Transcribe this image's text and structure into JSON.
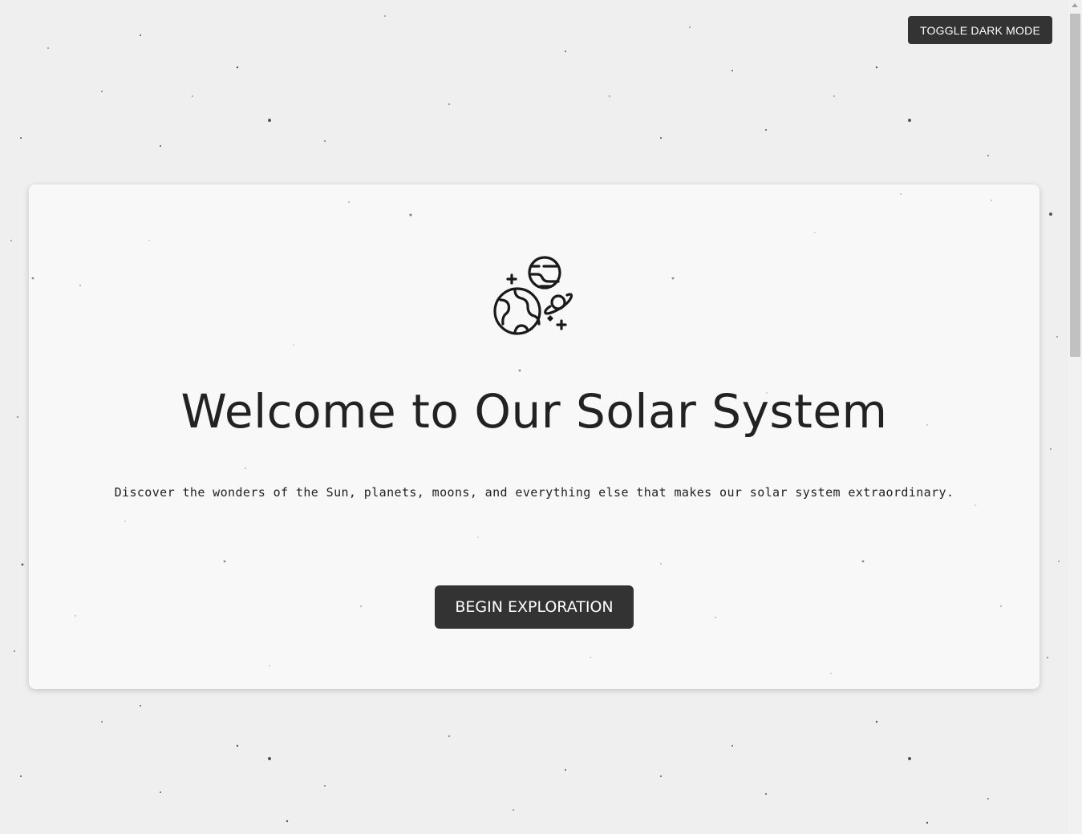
{
  "header": {
    "toggle_label": "TOGGLE DARK MODE"
  },
  "hero": {
    "icon": "planets-icon",
    "title": "Welcome to Our Solar System",
    "subtitle": "Discover the wonders of the Sun, planets, moons, and everything else that makes our solar system extraordinary.",
    "cta_label": "BEGIN EXPLORATION"
  },
  "colors": {
    "page_background": "#efefef",
    "card_background": "#f8f8f8",
    "button_background": "#333333",
    "button_text": "#ffffff",
    "text": "#222222"
  }
}
